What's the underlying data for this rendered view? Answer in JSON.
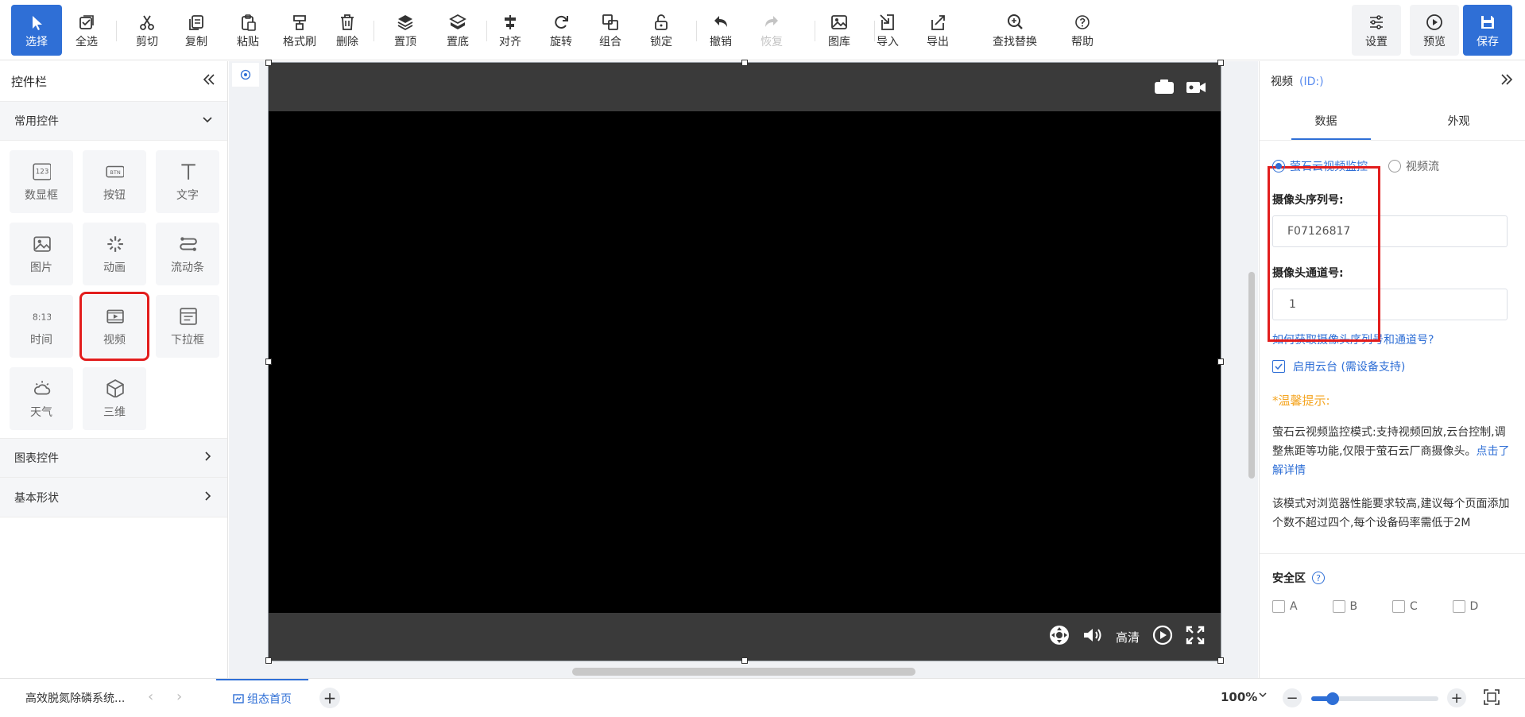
{
  "toolbar": {
    "left_items": [
      {
        "key": "select",
        "label": "选择",
        "icon": "cursor-icon",
        "active": true
      },
      {
        "key": "select_all",
        "label": "全选",
        "icon": "select-all-icon"
      },
      {
        "key": "cut",
        "label": "剪切",
        "icon": "scissors-icon"
      },
      {
        "key": "copy",
        "label": "复制",
        "icon": "copy-icon"
      },
      {
        "key": "paste",
        "label": "粘贴",
        "icon": "paste-icon"
      },
      {
        "key": "format_painter",
        "label": "格式刷",
        "icon": "format-brush-icon"
      },
      {
        "key": "delete",
        "label": "删除",
        "icon": "trash-icon"
      },
      {
        "key": "bring_top",
        "label": "置顶",
        "icon": "bring-to-front-icon"
      },
      {
        "key": "send_bottom",
        "label": "置底",
        "icon": "send-to-back-icon"
      },
      {
        "key": "align",
        "label": "对齐",
        "icon": "align-icon"
      },
      {
        "key": "rotate",
        "label": "旋转",
        "icon": "rotate-icon"
      },
      {
        "key": "group",
        "label": "组合",
        "icon": "group-icon"
      },
      {
        "key": "lock",
        "label": "锁定",
        "icon": "lock-icon"
      },
      {
        "key": "undo",
        "label": "撤销",
        "icon": "undo-icon"
      },
      {
        "key": "redo",
        "label": "恢复",
        "icon": "redo-icon",
        "disabled": true
      },
      {
        "key": "gallery",
        "label": "图库",
        "icon": "image-gallery-icon"
      },
      {
        "key": "import",
        "label": "导入",
        "icon": "import-icon"
      },
      {
        "key": "export",
        "label": "导出",
        "icon": "export-icon"
      },
      {
        "key": "find_replace",
        "label": "查找替换",
        "icon": "find-replace-icon"
      },
      {
        "key": "help",
        "label": "帮助",
        "icon": "help-icon"
      }
    ],
    "right_items": [
      {
        "key": "settings",
        "label": "设置",
        "icon": "settings-sliders-icon"
      },
      {
        "key": "preview",
        "label": "预览",
        "icon": "play-circle-icon"
      },
      {
        "key": "save",
        "label": "保存",
        "icon": "floppy-disk-icon"
      }
    ]
  },
  "left_panel": {
    "title": "控件栏",
    "common_section": "常用控件",
    "widgets": [
      {
        "label": "数显框",
        "icon": "number-display-icon"
      },
      {
        "label": "按钮",
        "icon": "button-widget-icon"
      },
      {
        "label": "文字",
        "icon": "text-icon"
      },
      {
        "label": "图片",
        "icon": "picture-icon"
      },
      {
        "label": "动画",
        "icon": "animation-icon"
      },
      {
        "label": "流动条",
        "icon": "flow-bar-icon"
      },
      {
        "label": "时间",
        "icon": "time-icon"
      },
      {
        "label": "视频",
        "icon": "video-icon",
        "highlighted": true
      },
      {
        "label": "下拉框",
        "icon": "dropdown-icon"
      },
      {
        "label": "天气",
        "icon": "weather-icon"
      },
      {
        "label": "三维",
        "icon": "cube-3d-icon"
      }
    ],
    "chart_section": "图表控件",
    "shape_section": "基本形状"
  },
  "canvas": {
    "video_controls": {
      "quality": "高清"
    }
  },
  "right_panel": {
    "title": "视频",
    "id_label": "(ID:)",
    "tabs": [
      "数据",
      "外观"
    ],
    "radio_options": [
      "萤石云视频监控",
      "视频流"
    ],
    "selected_radio": 0,
    "serial_label": "摄像头序列号:",
    "serial_value": "F07126817",
    "channel_label": "摄像头通道号:",
    "channel_value": "1",
    "help_link": "如何获取摄像头序列号和通道号?",
    "ptz_label": "启用云台 (需设备支持)",
    "ptz_checked": true,
    "tip_title": "*温馨提示:",
    "tip_para1": "萤石云视频监控模式:支持视频回放,云台控制,调整焦距等功能,仅限于萤石云厂商摄像头。",
    "tip_para1_link": "点击了解详情",
    "tip_para2": "该模式对浏览器性能要求较高,建议每个页面添加个数不超过四个,每个设备码率需低于2M",
    "safe_zone_title": "安全区",
    "safe_zone_options": [
      "A",
      "B",
      "C",
      "D"
    ]
  },
  "bottom_bar": {
    "file_name": "高效脱氮除磷系统...",
    "page_tab": "组态首页",
    "zoom_label": "100%",
    "zoom_fraction": 0.17
  },
  "colors": {
    "accent": "#2f6fd6",
    "highlight_red": "#e21d1d",
    "tip_orange": "#f5a623"
  }
}
